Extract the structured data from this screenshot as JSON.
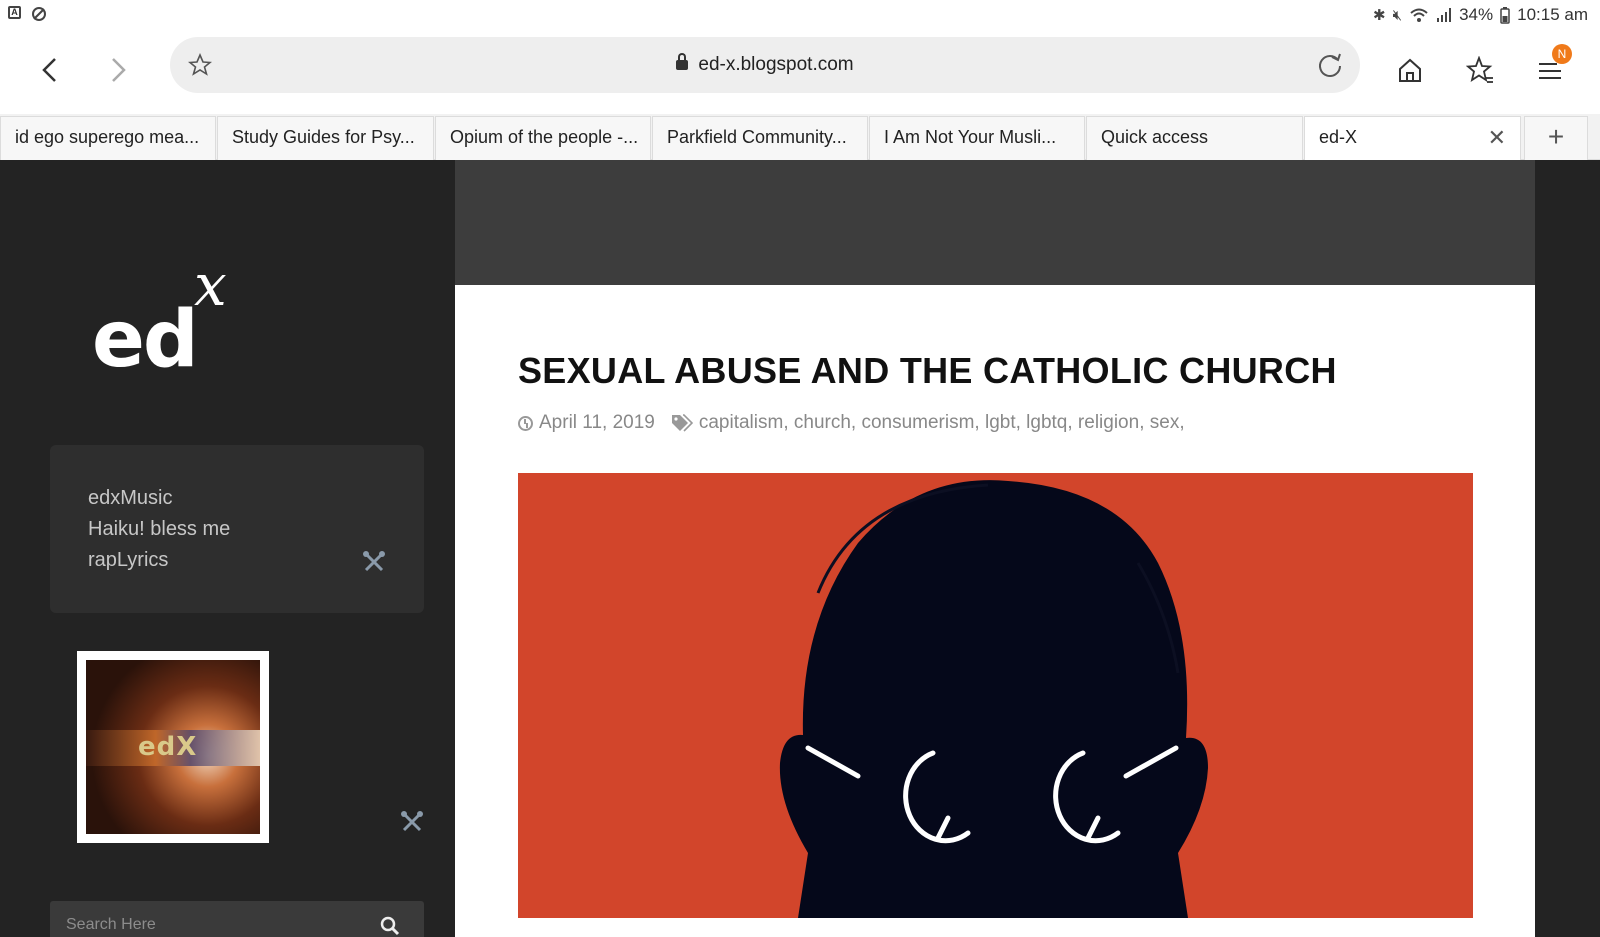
{
  "status_bar": {
    "battery": "34%",
    "time": "10:15 am"
  },
  "browser": {
    "url": "ed-x.blogspot.com",
    "profile_badge": "N"
  },
  "tabs": [
    {
      "label": "id ego superego mea..."
    },
    {
      "label": "Study Guides for Psy..."
    },
    {
      "label": "Opium of the people -..."
    },
    {
      "label": "Parkfield Community..."
    },
    {
      "label": "I Am Not Your Musli..."
    },
    {
      "label": "Quick access"
    },
    {
      "label": "ed-X"
    }
  ],
  "sidebar": {
    "logo": {
      "main": "ed",
      "sup": "x"
    },
    "links": [
      {
        "label": "edxMusic"
      },
      {
        "label": "Haiku! bless me"
      },
      {
        "label": "rapLyrics"
      }
    ],
    "thumbnail_text": "edX",
    "search": {
      "placeholder": "Search Here"
    }
  },
  "post": {
    "title": "SEXUAL ABUSE AND THE CATHOLIC CHURCH",
    "date": "April 11, 2019",
    "tags": "capitalism, church, consumerism, lgbt, lgbtq, religion, sex,"
  },
  "colors": {
    "hero_bg": "#d2452b",
    "sidebar_bg": "#232323",
    "badge": "#f07a1a"
  }
}
